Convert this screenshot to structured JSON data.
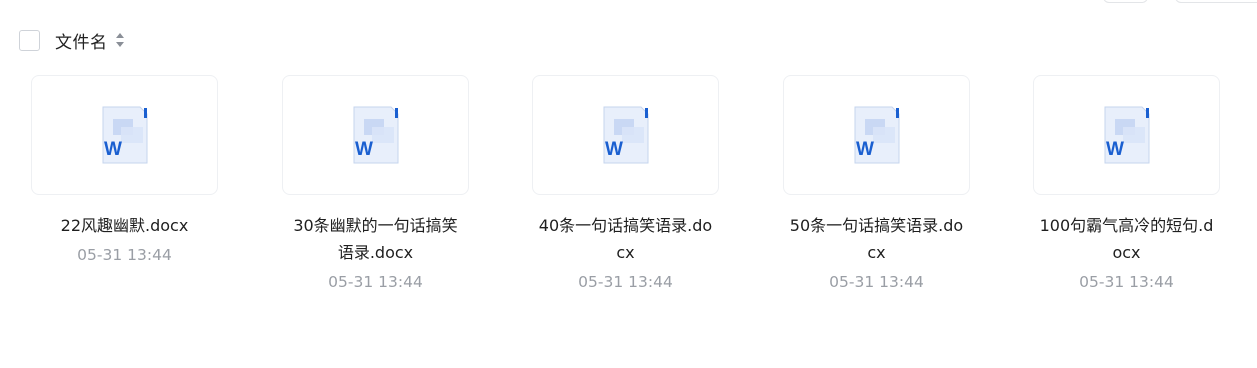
{
  "header": {
    "select_all_checked": false,
    "column_label": "文件名",
    "sort_icon": "sort-updown-icon"
  },
  "files": [
    {
      "name": "22风趣幽默.docx",
      "date": "05-31 13:44",
      "icon": "word-doc-icon"
    },
    {
      "name": "30条幽默的一句话搞笑语录.docx",
      "date": "05-31 13:44",
      "icon": "word-doc-icon"
    },
    {
      "name": "40条一句话搞笑语录.docx",
      "date": "05-31 13:44",
      "icon": "word-doc-icon"
    },
    {
      "name": "50条一句话搞笑语录.docx",
      "date": "05-31 13:44",
      "icon": "word-doc-icon"
    },
    {
      "name": "100句霸气高冷的短句.docx",
      "date": "05-31 13:44",
      "icon": "word-doc-icon"
    }
  ],
  "colors": {
    "word_blue": "#1a5fd0",
    "doc_body": "#e8effb",
    "doc_fold": "#c9d8f4",
    "date_gray": "#9a9ea5"
  }
}
